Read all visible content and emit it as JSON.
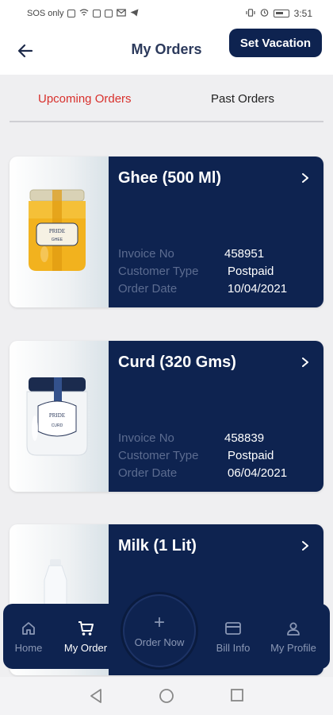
{
  "status_bar": {
    "left_text": "SOS only",
    "time": "3:51"
  },
  "header": {
    "title": "My Orders",
    "back_icon": "arrow-left-icon",
    "vacation_label": "Set Vacation"
  },
  "tabs": [
    {
      "label": "Upcoming Orders",
      "active": true
    },
    {
      "label": "Past Orders",
      "active": false
    }
  ],
  "detail_labels": {
    "invoice": "Invoice No",
    "customer_type": "Customer Type",
    "order_date": "Order Date"
  },
  "orders": [
    {
      "product": "Ghee (500 Ml)",
      "invoice_no": "458951",
      "customer_type": "Postpaid",
      "order_date": "10/04/2021",
      "image": "ghee-jar"
    },
    {
      "product": "Curd (320 Gms)",
      "invoice_no": "458839",
      "customer_type": "Postpaid",
      "order_date": "06/04/2021",
      "image": "curd-jar"
    },
    {
      "product": "Milk (1 Lit)",
      "image": "milk-bottle"
    }
  ],
  "bottom_nav": {
    "home": "Home",
    "my_order": "My Order",
    "order_now": "Order Now",
    "bill_info": "Bill Info",
    "my_profile": "My Profile"
  },
  "colors": {
    "brand_navy": "#0e2350",
    "active_tab": "#d8302c",
    "muted_label": "#5c6c90"
  }
}
